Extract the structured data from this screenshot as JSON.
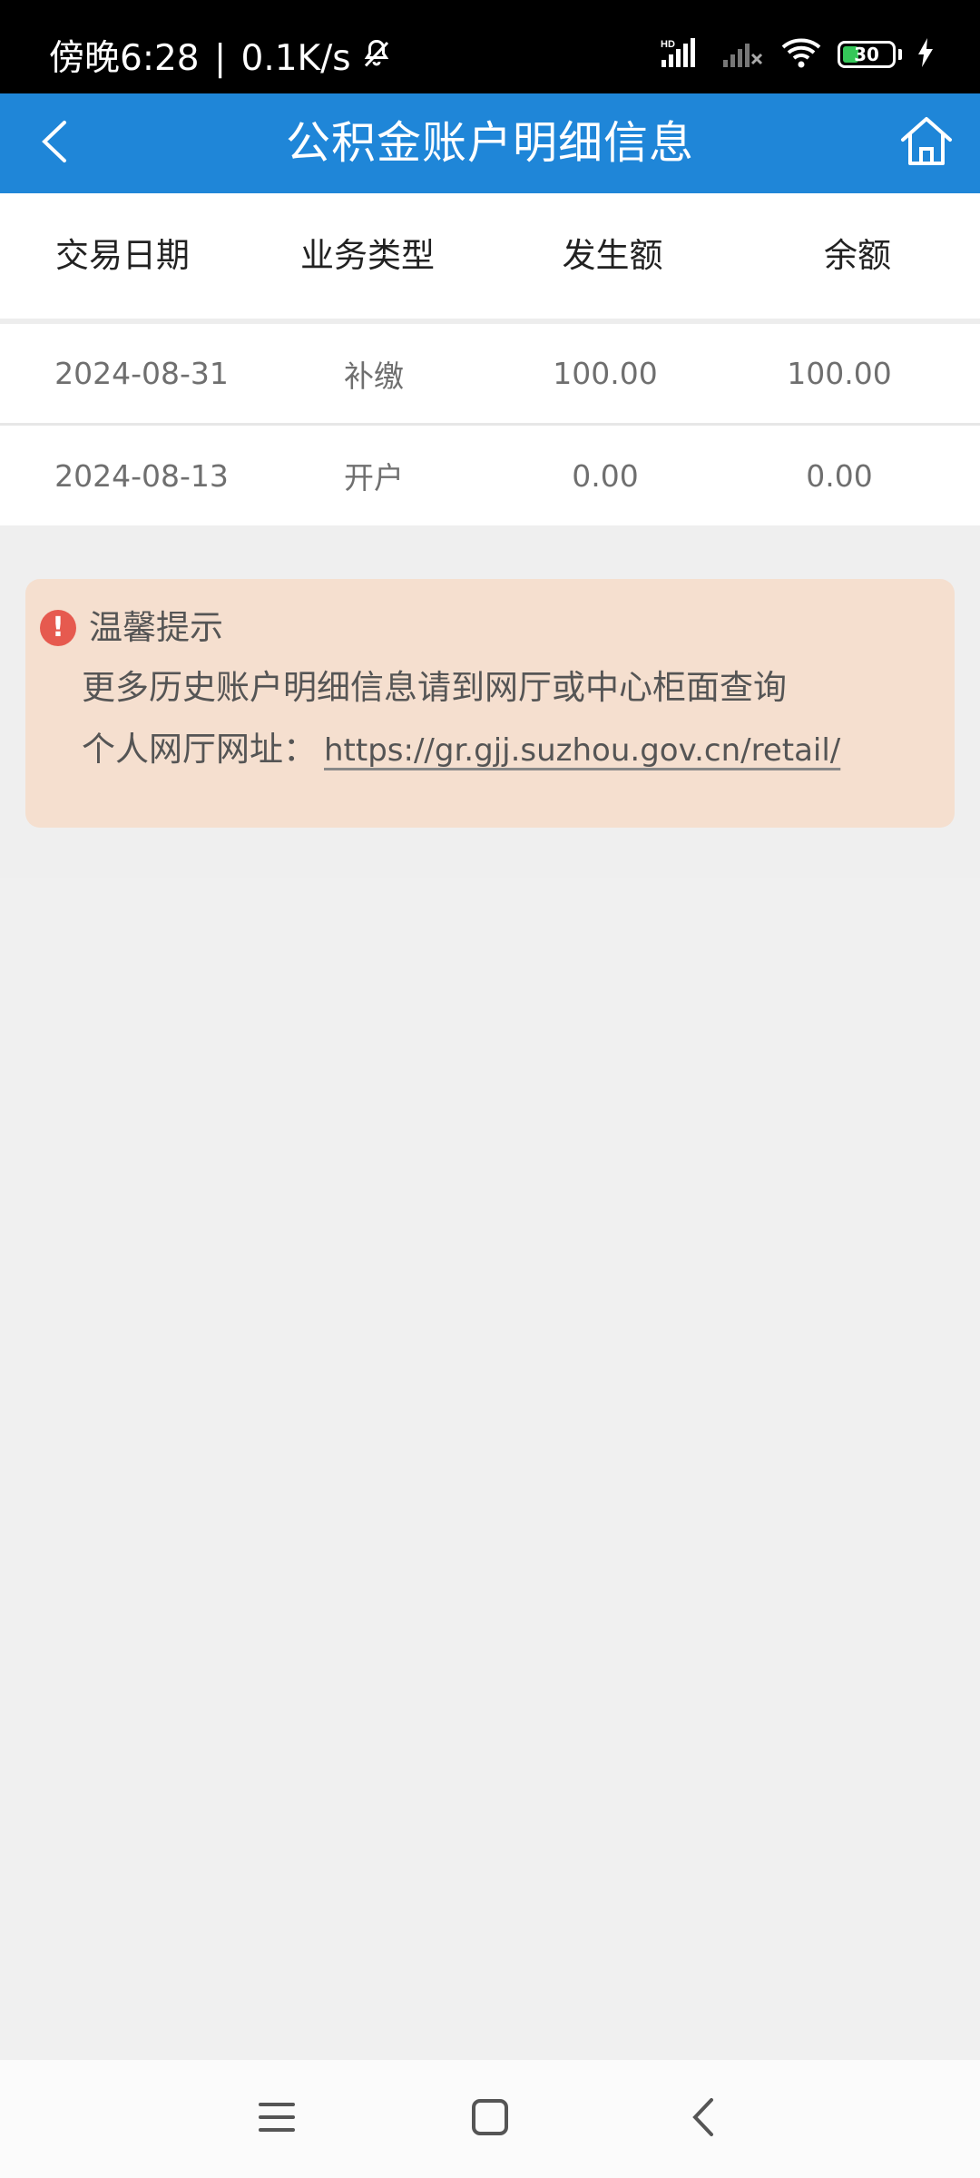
{
  "status_bar": {
    "time": "傍晚6:28",
    "network_speed": "0.1K/s",
    "battery_level": "30",
    "icons": [
      "mute-bell-icon",
      "hd-signal-icon",
      "no-signal-icon",
      "wifi-icon",
      "battery-icon",
      "charging-icon"
    ]
  },
  "header": {
    "title": "公积金账户明细信息",
    "back_icon": "chevron-left-icon",
    "home_icon": "home-icon",
    "background": "#1f86d8"
  },
  "table": {
    "columns": [
      "交易日期",
      "业务类型",
      "发生额",
      "余额"
    ],
    "rows": [
      [
        "2024-08-31",
        "补缴",
        "100.00",
        "100.00"
      ],
      [
        "2024-08-13",
        "开户",
        "0.00",
        "0.00"
      ]
    ]
  },
  "tip": {
    "title": "温馨提示",
    "line1": "更多历史账户明细信息请到网厅或中心柜面查询",
    "line2_label": "个人网厅网址：",
    "link_text": "https://gr.gjj.suzhou.gov.cn/retail/",
    "background": "#f5dfcf",
    "icon_color": "#e65a4f"
  },
  "nav": {
    "icons": [
      "menu-icon",
      "home-square-icon",
      "back-chevron-icon"
    ]
  }
}
